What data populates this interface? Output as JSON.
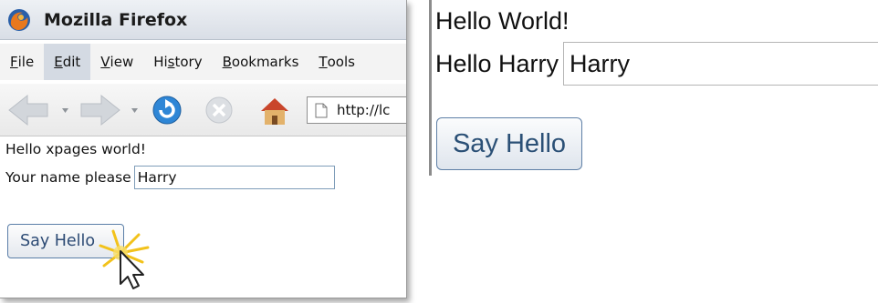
{
  "browser": {
    "title": "Mozilla Firefox",
    "menu": [
      {
        "pre": "",
        "ul": "F",
        "post": "ile"
      },
      {
        "pre": "",
        "ul": "E",
        "post": "dit"
      },
      {
        "pre": "",
        "ul": "V",
        "post": "iew"
      },
      {
        "pre": "Hi",
        "ul": "s",
        "post": "tory"
      },
      {
        "pre": "",
        "ul": "B",
        "post": "ookmarks"
      },
      {
        "pre": "",
        "ul": "T",
        "post": "ools"
      }
    ],
    "active_menu": "Edit",
    "url": "http://lc",
    "icons": [
      "firefox-logo-icon",
      "back-arrow-icon",
      "forward-arrow-icon",
      "reload-icon",
      "stop-icon",
      "home-icon",
      "page-icon",
      "mouse-cursor-icon"
    ]
  },
  "small_page": {
    "greeting": "Hello xpages world!",
    "name_label": "Your name please",
    "name_value": "Harry",
    "button_label": "Say Hello"
  },
  "big_page": {
    "greeting": "Hello World!",
    "hello_label": "Hello Harry",
    "name_value": "Harry",
    "button_label": "Say Hello"
  },
  "colors": {
    "titlebar": "#d9dee6",
    "button_text": "#2c4a74",
    "input_border": "#7f9db9",
    "reload_blue": "#2e86d6"
  }
}
